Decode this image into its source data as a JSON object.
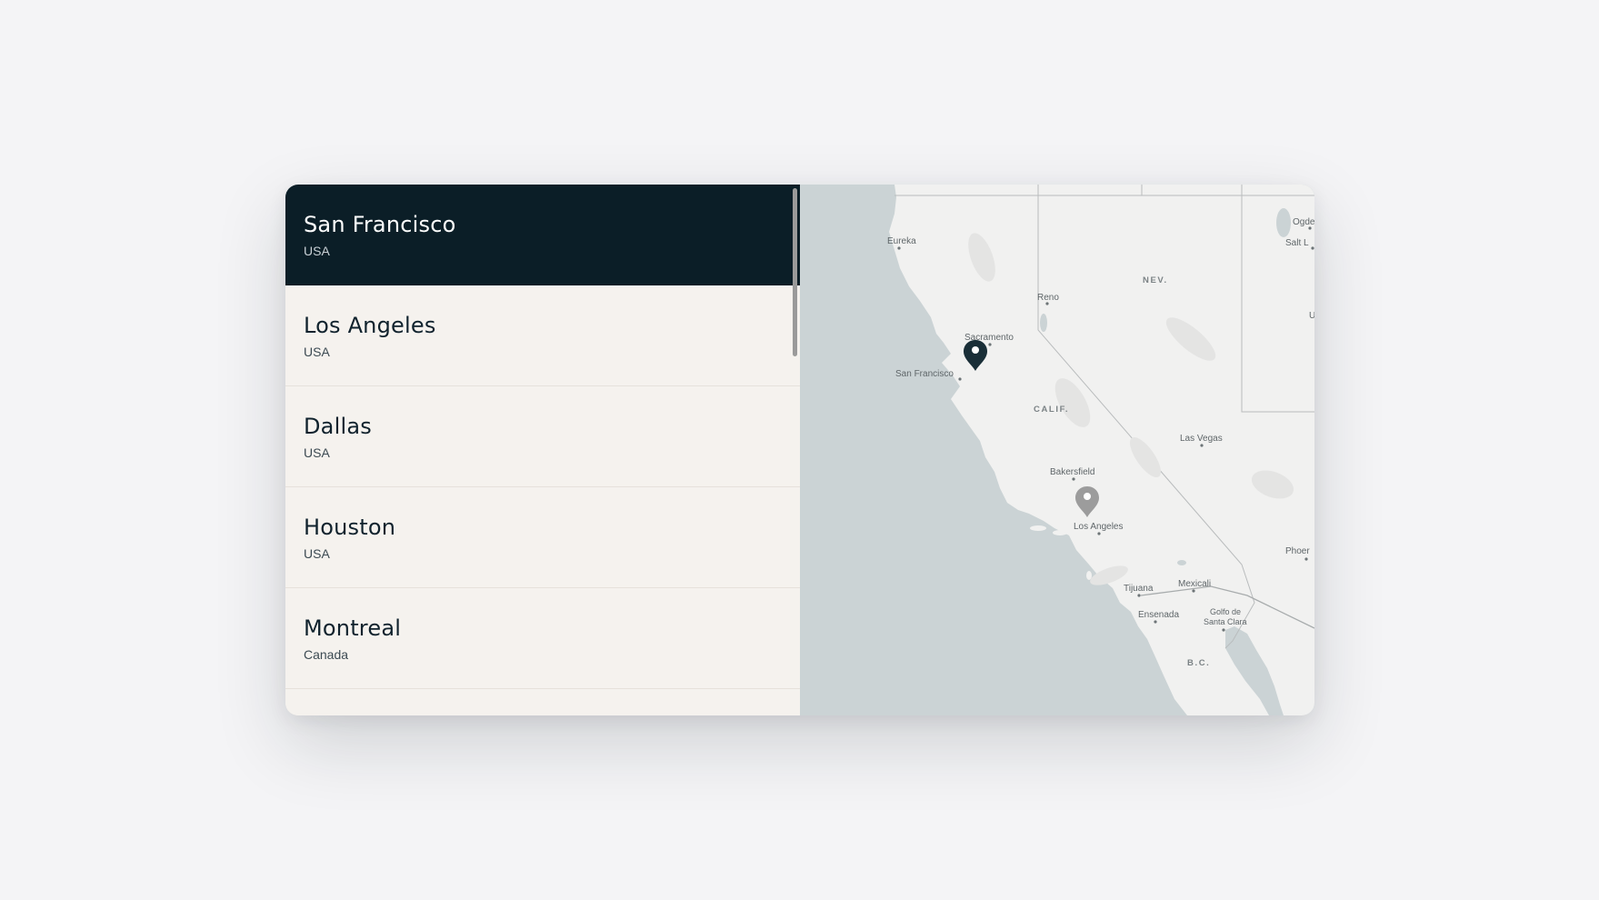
{
  "locations": [
    {
      "city": "San Francisco",
      "country": "USA",
      "selected": true
    },
    {
      "city": "Los Angeles",
      "country": "USA",
      "selected": false
    },
    {
      "city": "Dallas",
      "country": "USA",
      "selected": false
    },
    {
      "city": "Houston",
      "country": "USA",
      "selected": false
    },
    {
      "city": "Montreal",
      "country": "Canada",
      "selected": false
    }
  ],
  "map": {
    "labels": {
      "eureka": "Eureka",
      "reno": "Reno",
      "sacramento": "Sacramento",
      "san_francisco": "San Francisco",
      "las_vegas": "Las Vegas",
      "bakersfield": "Bakersfield",
      "los_angeles": "Los Angeles",
      "tijuana": "Tijuana",
      "mexicali": "Mexicali",
      "ensenada": "Ensenada",
      "golfo_1": "Golfo de",
      "golfo_2": "Santa Clara",
      "phoenix": "Phoer",
      "ogden": "Ogde",
      "salt_lake": "Salt L",
      "utah_cut": "U"
    },
    "states": {
      "nevada": "NEV.",
      "california": "CALIF.",
      "baja": "B.C."
    },
    "pins": {
      "active_color": "#1a2f38",
      "inactive_color": "#9c9c9c"
    }
  }
}
